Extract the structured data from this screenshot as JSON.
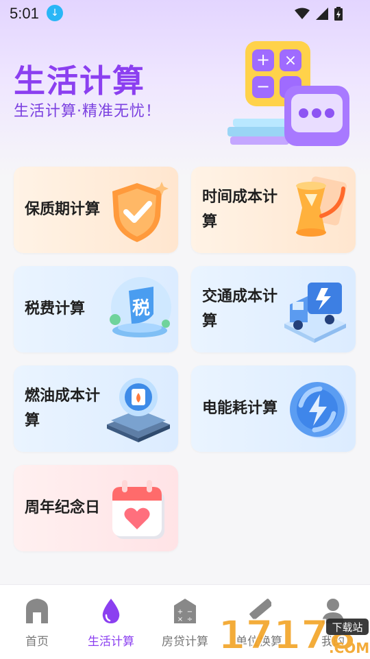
{
  "status_bar": {
    "time": "5:01"
  },
  "header": {
    "title": "生活计算",
    "subtitle": "生活计算·精准无忧！"
  },
  "cards": [
    {
      "label": "保质期计算",
      "icon": "shield-check-icon",
      "theme": "orange"
    },
    {
      "label": "时间成本计算",
      "icon": "hourglass-icon",
      "theme": "orange"
    },
    {
      "label": "税费计算",
      "icon": "tax-icon",
      "theme": "blue"
    },
    {
      "label": "交通成本计算",
      "icon": "truck-icon",
      "theme": "blue"
    },
    {
      "label": "燃油成本计算",
      "icon": "fuel-icon",
      "theme": "blue"
    },
    {
      "label": "电能耗计算",
      "icon": "lightning-icon",
      "theme": "blue"
    },
    {
      "label": "周年纪念日",
      "icon": "calendar-heart-icon",
      "theme": "pink"
    }
  ],
  "bottom_nav": [
    {
      "label": "首页",
      "icon": "home-icon",
      "active": false
    },
    {
      "label": "生活计算",
      "icon": "drop-icon",
      "active": true
    },
    {
      "label": "房贷计算",
      "icon": "calculator-icon",
      "active": false
    },
    {
      "label": "单位换算",
      "icon": "ruler-icon",
      "active": false
    },
    {
      "label": "我的",
      "icon": "user-icon",
      "active": false
    }
  ],
  "watermark": {
    "brand": "17178",
    "suffix": ".COM",
    "tag": "下载站"
  },
  "colors": {
    "accent": "#8b3ff0",
    "nav_inactive": "#777777",
    "orange_card": "#ffe6cf",
    "blue_card": "#dcecff",
    "pink_card": "#ffe3e6"
  }
}
